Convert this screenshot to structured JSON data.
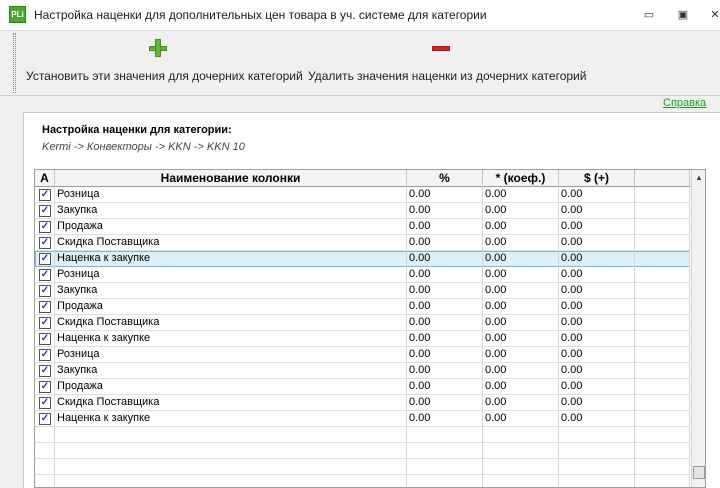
{
  "window": {
    "title": "Настройка наценки для дополнительных цен товара в уч. системе для категории",
    "app_icon_text": "PLi",
    "minimize": "▭",
    "maximize": "▣",
    "close": "✕"
  },
  "toolbar": {
    "set_label": "Установить эти значения для дочерних категорий",
    "delete_label": "Удалить значения наценки из дочерних категорий",
    "set_icon": "plus-icon",
    "delete_icon": "minus-icon",
    "colors": {
      "plus": "#5cb832",
      "minus": "#e02020"
    }
  },
  "help_link": "Справка",
  "section": {
    "title": "Настройка наценки для категории:",
    "breadcrumb": "Kermi -> Конвекторы -> KKN -> KKN 10"
  },
  "grid": {
    "columns": [
      "A",
      "Наименование колонки",
      "%",
      "* (коеф.)",
      "$ (+)"
    ],
    "selected_row_index": 4,
    "rows": [
      {
        "checked": true,
        "name": "Розница",
        "percent": "0.00",
        "coef": "0.00",
        "plus": "0.00"
      },
      {
        "checked": true,
        "name": "Закупка",
        "percent": "0.00",
        "coef": "0.00",
        "plus": "0.00"
      },
      {
        "checked": true,
        "name": "Продажа",
        "percent": "0.00",
        "coef": "0.00",
        "plus": "0.00"
      },
      {
        "checked": true,
        "name": "Скидка Поставщика",
        "percent": "0.00",
        "coef": "0.00",
        "plus": "0.00"
      },
      {
        "checked": true,
        "name": "Наценка к закупке",
        "percent": "0.00",
        "coef": "0.00",
        "plus": "0.00"
      },
      {
        "checked": true,
        "name": "Розница",
        "percent": "0.00",
        "coef": "0.00",
        "plus": "0.00"
      },
      {
        "checked": true,
        "name": "Закупка",
        "percent": "0.00",
        "coef": "0.00",
        "plus": "0.00"
      },
      {
        "checked": true,
        "name": "Продажа",
        "percent": "0.00",
        "coef": "0.00",
        "plus": "0.00"
      },
      {
        "checked": true,
        "name": "Скидка Поставщика",
        "percent": "0.00",
        "coef": "0.00",
        "plus": "0.00"
      },
      {
        "checked": true,
        "name": "Наценка к закупке",
        "percent": "0.00",
        "coef": "0.00",
        "plus": "0.00"
      },
      {
        "checked": true,
        "name": "Розница",
        "percent": "0.00",
        "coef": "0.00",
        "plus": "0.00"
      },
      {
        "checked": true,
        "name": "Закупка",
        "percent": "0.00",
        "coef": "0.00",
        "plus": "0.00"
      },
      {
        "checked": true,
        "name": "Продажа",
        "percent": "0.00",
        "coef": "0.00",
        "plus": "0.00"
      },
      {
        "checked": true,
        "name": "Скидка Поставщика",
        "percent": "0.00",
        "coef": "0.00",
        "plus": "0.00"
      },
      {
        "checked": true,
        "name": "Наценка к закупке",
        "percent": "0.00",
        "coef": "0.00",
        "plus": "0.00"
      }
    ],
    "check_mark": "✓",
    "scroll_up": "▲"
  }
}
